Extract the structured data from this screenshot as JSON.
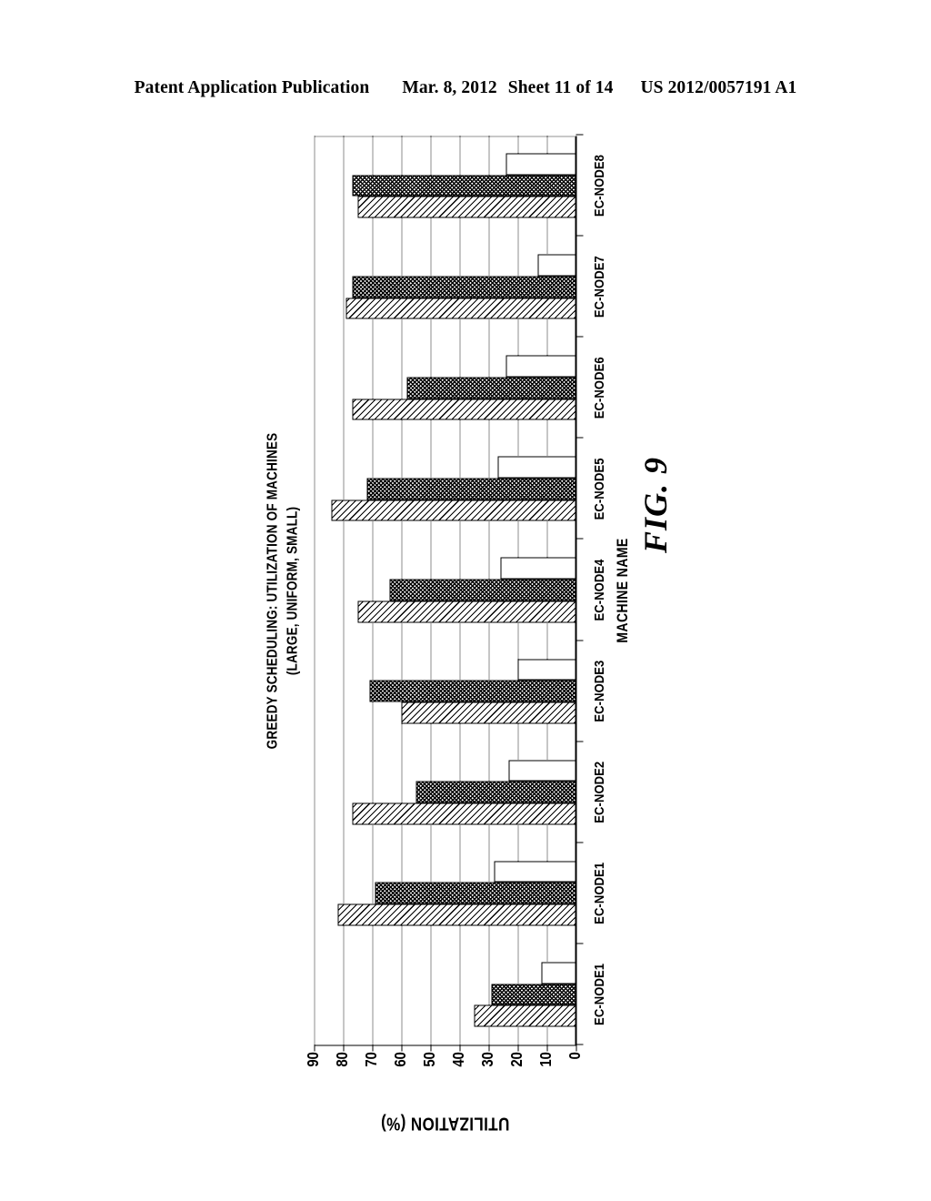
{
  "header": {
    "publication": "Patent Application Publication",
    "date": "Mar. 8, 2012",
    "sheet": "Sheet 11 of 14",
    "number": "US 2012/0057191 A1"
  },
  "figure": {
    "caption": "FIG. 9"
  },
  "chart_data": {
    "type": "bar",
    "orientation": "vertical-printed-sideways",
    "title": "GREEDY SCHEDULING: UTILIZATION OF MACHINES",
    "subtitle": "(LARGE, UNIFORM, SMALL)",
    "xlabel": "MACHINE NAME",
    "ylabel": "UTILIZATION (%)",
    "ylim": [
      0,
      90
    ],
    "yticks": [
      0,
      10,
      20,
      30,
      40,
      50,
      60,
      70,
      80,
      90
    ],
    "ytick_labels": [
      "0",
      "10",
      "20",
      "30",
      "40",
      "50",
      "60",
      "70",
      "80",
      "90"
    ],
    "grid": true,
    "legend": null,
    "categories": [
      "EC-NODE1",
      "EC-NODE1",
      "EC-NODE2",
      "EC-NODE3",
      "EC-NODE4",
      "EC-NODE5",
      "EC-NODE6",
      "EC-NODE7",
      "EC-NODE8"
    ],
    "series": [
      {
        "name": "LARGE",
        "pattern": "diagonal-hatch",
        "values": [
          35,
          82,
          77,
          60,
          75,
          84,
          77,
          79,
          75
        ]
      },
      {
        "name": "UNIFORM",
        "pattern": "cross-hatch",
        "values": [
          29,
          69,
          55,
          71,
          64,
          72,
          58,
          77,
          77
        ]
      },
      {
        "name": "SMALL",
        "pattern": "open",
        "values": [
          12,
          28,
          23,
          20,
          26,
          27,
          24,
          13,
          24
        ]
      }
    ]
  }
}
